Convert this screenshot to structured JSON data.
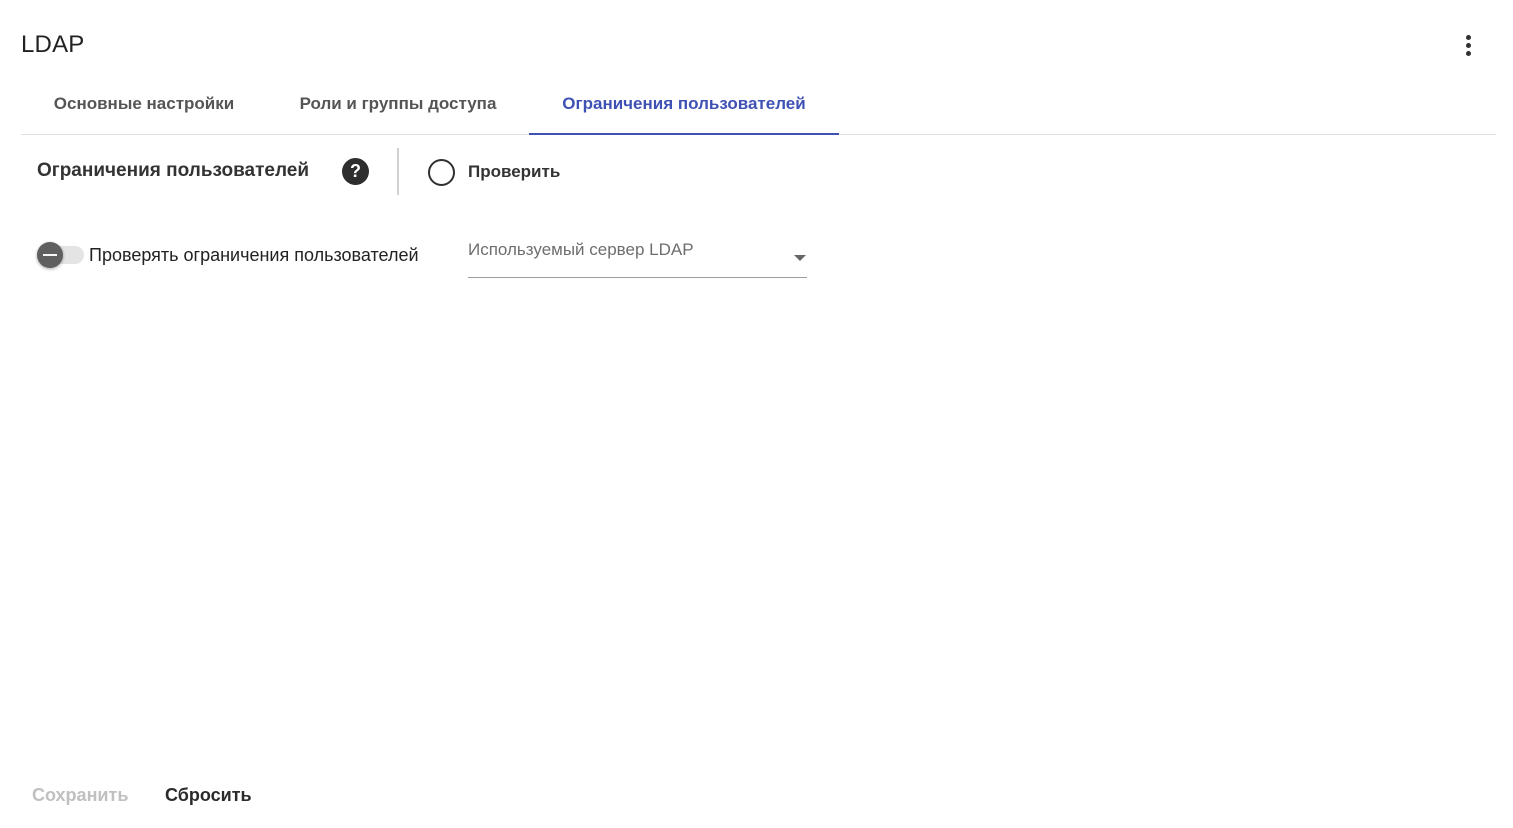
{
  "header": {
    "title": "LDAP",
    "menu_icon": "more-vert-icon"
  },
  "tabs": [
    {
      "label": "Основные настройки",
      "active": false
    },
    {
      "label": "Роли и группы доступа",
      "active": false
    },
    {
      "label": "Ограничения пользователей",
      "active": true
    }
  ],
  "section": {
    "title": "Ограничения пользователей",
    "help_icon": "help-circle-icon",
    "help_glyph": "?",
    "check_label": "Проверить",
    "check_icon": "circle-outline-icon"
  },
  "form": {
    "toggle": {
      "label": "Проверять ограничения пользователей",
      "checked": false
    },
    "ldap_server": {
      "label": "Используемый сервер LDAP",
      "value": ""
    }
  },
  "footer": {
    "save_label": "Сохранить",
    "save_enabled": false,
    "reset_label": "Сбросить"
  },
  "colors": {
    "accent": "#3f51b5",
    "text": "#303030",
    "disabled": "#c0c0c0"
  }
}
